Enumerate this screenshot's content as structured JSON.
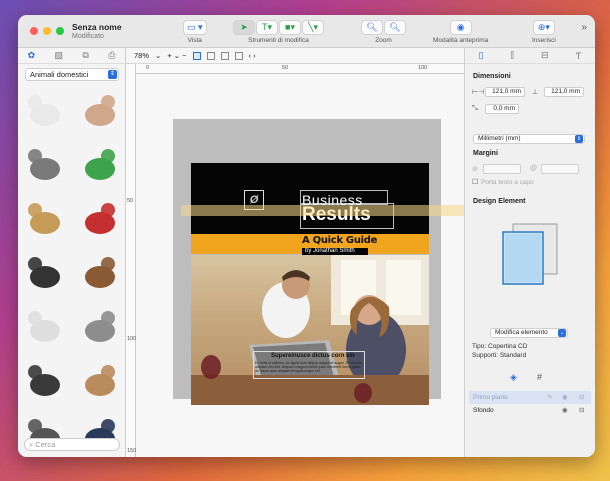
{
  "document": {
    "title": "Senza nome",
    "subtitle": "Modificato"
  },
  "toolbar": {
    "view_label": "Vista",
    "tools_label": "Strumenti di modifica",
    "zoom_label": "Zoom",
    "preview_label": "Modalità anteprima",
    "insert_label": "Inserisci"
  },
  "left_panel": {
    "category": "Animali domestici",
    "search_placeholder": "Cerca",
    "clips": [
      {
        "name": "cat-lying-white",
        "color": "#e9e9e9"
      },
      {
        "name": "kitten-sitting",
        "color": "#cfa88b"
      },
      {
        "name": "rabbits-pair",
        "color": "#7a7a7a"
      },
      {
        "name": "parrots-green",
        "color": "#3fa34d"
      },
      {
        "name": "parrot-on-hand",
        "color": "#c69a57"
      },
      {
        "name": "birdcage-red",
        "color": "#c62f2f"
      },
      {
        "name": "puppy-black-white",
        "color": "#333333"
      },
      {
        "name": "dog-lying-brown",
        "color": "#8a5a34"
      },
      {
        "name": "jack-russell",
        "color": "#dedede"
      },
      {
        "name": "dog-bw-photo",
        "color": "#8d8d8d"
      },
      {
        "name": "cat-black-photo",
        "color": "#3a3a3a"
      },
      {
        "name": "basset-hound",
        "color": "#b98c5e"
      },
      {
        "name": "dog-strip",
        "color": "#555555"
      },
      {
        "name": "cat-strip",
        "color": "#2a3a5a"
      }
    ]
  },
  "canvas": {
    "zoom": "78%",
    "ruler_top": [
      "0",
      "50",
      "100"
    ],
    "ruler_left": [
      "50",
      "100",
      "150"
    ]
  },
  "cover": {
    "title_line1": "Business",
    "title_line2": "Results",
    "subtitle": "A Quick Guide",
    "byline": "by Jonathan Smith",
    "photo_title": "Supereinusce dictus corn sin",
    "photo_body": "Eo tellis id ullamus. Ac ligula dum aliquip magna et augue. Et lobortis aliquam nisl sed. Aliquam magna euerim justo hendrerit lorem ipsum. Ac ipsum dum aliquam et ligula augue vel."
  },
  "right_panel": {
    "dimensions_label": "Dimensioni",
    "width_value": "121,0 mm",
    "height_value": "121,0 mm",
    "depth_value": "0,0 mm",
    "units": "Millimetri (mm)",
    "margins_label": "Margini",
    "margin_a": "",
    "margin_b": "",
    "bleed_label": "Porta testo a capo",
    "design_element_label": "Design Element",
    "edit_element_label": "Modifica elemento",
    "type_text": "Tipo: Copertina CD",
    "supports_text": "Supporti: Standard",
    "layers": [
      {
        "name": "Primo piano",
        "selected": true
      },
      {
        "name": "Sfondo",
        "selected": false
      }
    ]
  }
}
